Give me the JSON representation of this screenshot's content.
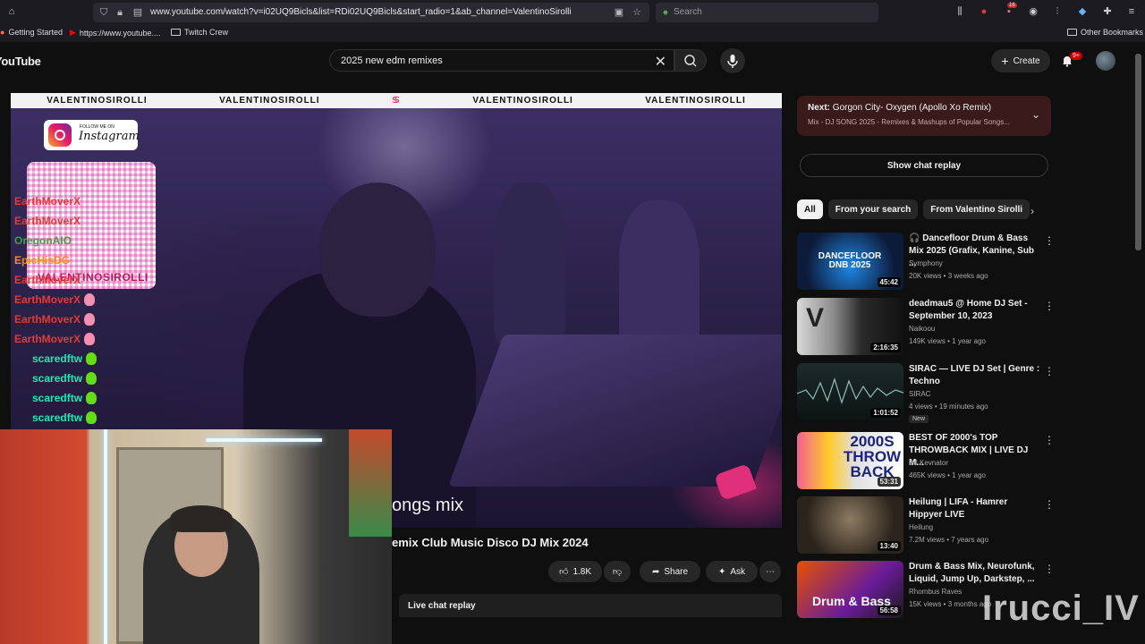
{
  "browser": {
    "url": "www.youtube.com/watch?v=i02UQ9Bicls&list=RDi02UQ9Bicls&start_radio=1&ab_channel=ValentinoSirolli",
    "search_placeholder": "Search",
    "bookmarks": [
      "Getting Started",
      "https://www.youtube....",
      "Twitch Crew"
    ],
    "other_bookmarks": "Other Bookmarks",
    "notif_count": "16"
  },
  "header": {
    "logo": "YouTube",
    "search_query": "2025 new edm remixes",
    "create_label": "Create",
    "notif_badge": "9+"
  },
  "player": {
    "banner_text": "VALENTINOSIROLLI",
    "instagram_follow": "FOLLOW ME ON",
    "instagram_label": "Instagram",
    "qr_name": "VALENTINOSIROLLI",
    "overlay_text": "ongs mix",
    "chat": [
      {
        "user": "EarthMoverX",
        "color": "#e53935"
      },
      {
        "user": "EarthMoverX",
        "color": "#e53935"
      },
      {
        "user": "OregonAIO",
        "color": "#43a047"
      },
      {
        "user": "EpicHisDG",
        "color": "#fb8c00"
      },
      {
        "user": "EarthMoverX",
        "color": "#e53935"
      },
      {
        "user": "EarthMoverX",
        "color": "#e53935"
      },
      {
        "user": "EarthMoverX",
        "color": "#e53935"
      },
      {
        "user": "EarthMoverX",
        "color": "#e53935"
      },
      {
        "user": "scaredftw",
        "color": "#1de9b6"
      },
      {
        "user": "scaredftw",
        "color": "#1de9b6"
      },
      {
        "user": "scaredftw",
        "color": "#1de9b6"
      },
      {
        "user": "scaredftw",
        "color": "#1de9b6"
      }
    ]
  },
  "video": {
    "title": "emix Club Music Disco DJ Mix 2024",
    "likes": "1.8K",
    "share_label": "Share",
    "ask_label": "Ask",
    "live_chat_label": "Live chat replay"
  },
  "sidebar": {
    "next_prefix": "Next:",
    "next_title": "Gorgon City- Oxygen (Apollo Xo Remix)",
    "next_subtitle": "Mix - DJ SONG 2025 - Remixes & Mashups of Popular Songs...",
    "show_chat": "Show chat replay",
    "chips": [
      "All",
      "From your search",
      "From Valentino Sirolli"
    ],
    "recommendations": [
      {
        "title": "🎧 Dancefloor Drum & Bass Mix 2025 (Grafix, Kanine, Sub ...",
        "channel": "Symphony",
        "meta": "20K views • 3 weeks ago",
        "duration": "45:42",
        "thumb_text": "DANCEFLOOR DNB 2025",
        "is_new": false
      },
      {
        "title": "deadmau5 @ Home DJ Set - September 10, 2023",
        "channel": "Naikoou",
        "meta": "149K views • 1 year ago",
        "duration": "2:16:35",
        "thumb_text": "",
        "is_new": false
      },
      {
        "title": "SIRAC — LIVE DJ Set | Genre : Techno",
        "channel": "SIRAC",
        "meta": "4 views • 19 minutes ago",
        "duration": "1:01:52",
        "thumb_text": "",
        "is_new": true,
        "new_label": "New"
      },
      {
        "title": "BEST OF 2000's TOP THROWBACK MIX | LIVE DJ M...",
        "channel": "DJ Kevnator",
        "meta": "465K views • 1 year ago",
        "duration": "53:31",
        "thumb_text": "2000S THROW BACK",
        "is_new": false
      },
      {
        "title": "Heilung | LIFA - Hamrer Hippyer LIVE",
        "channel": "Heilung",
        "meta": "7.2M views • 7 years ago",
        "duration": "13:40",
        "thumb_text": "",
        "is_new": false
      },
      {
        "title": "Drum & Bass Mix, Neurofunk, Liquid, Jump Up, Darkstep, ...",
        "channel": "Rhombus Raves",
        "meta": "15K views • 3 months ago",
        "duration": "56:58",
        "thumb_text": "Drum & Bass",
        "is_new": false
      }
    ]
  },
  "watermark": "Irucci_IV",
  "colors": {
    "accent": "#cc0000",
    "next_card": "#3a1a1a",
    "chip_active": "#f1f1f1"
  }
}
